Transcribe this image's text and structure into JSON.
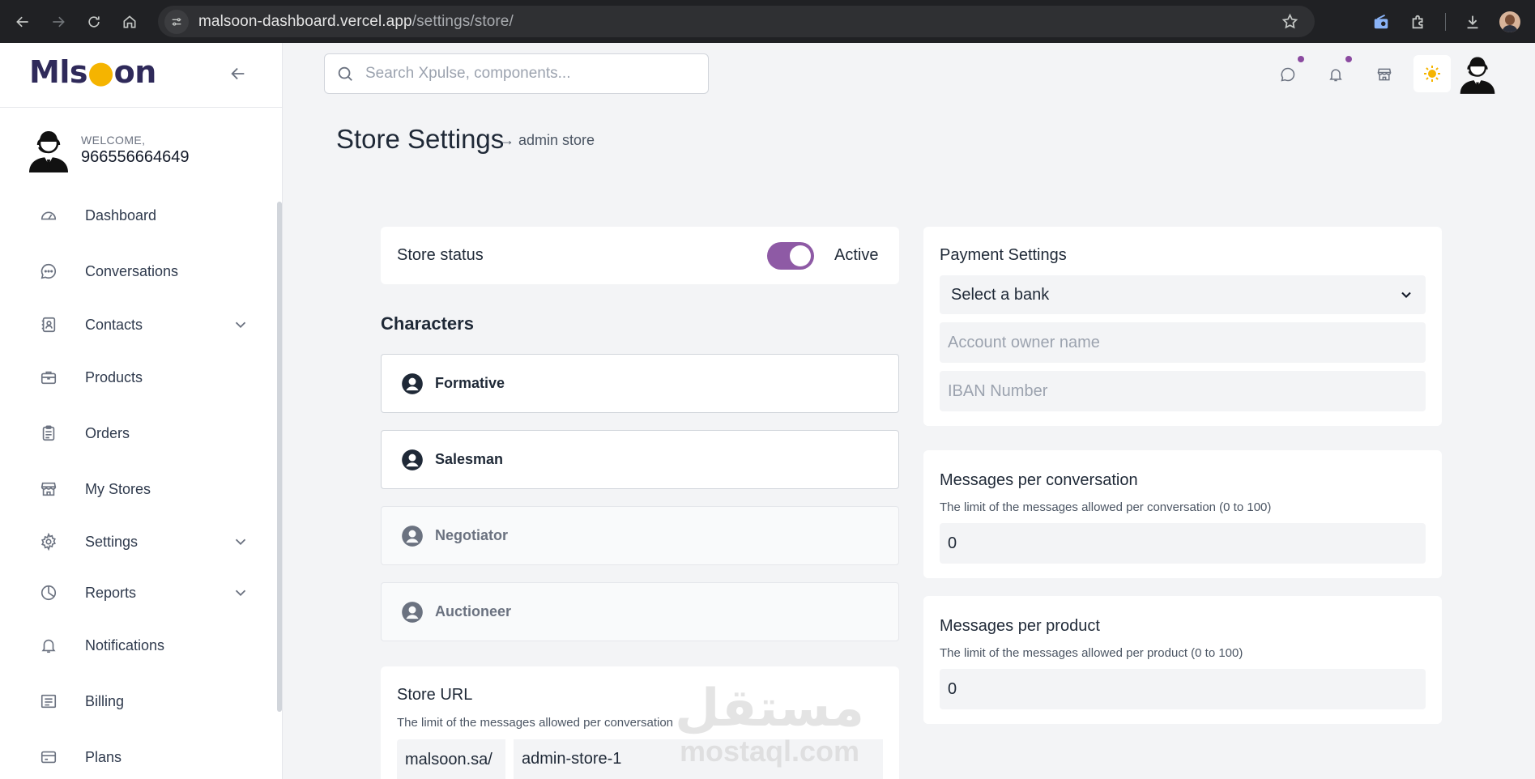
{
  "browser": {
    "url_host": "malsoon-dashboard.vercel.app",
    "url_path": "/settings/store/"
  },
  "sidebar": {
    "logo_text": "Mlsoon",
    "welcome_label": "WELCOME,",
    "user_name": "966556664649",
    "items": [
      {
        "label": "Dashboard",
        "icon": "gauge-icon",
        "has_submenu": false
      },
      {
        "label": "Conversations",
        "icon": "chat-bubble-icon",
        "has_submenu": false
      },
      {
        "label": "Contacts",
        "icon": "contact-book-icon",
        "has_submenu": true
      },
      {
        "label": "Products",
        "icon": "briefcase-icon",
        "has_submenu": false
      },
      {
        "label": "Orders",
        "icon": "clipboard-icon",
        "has_submenu": false
      },
      {
        "label": "My Stores",
        "icon": "store-icon",
        "has_submenu": false
      },
      {
        "label": "Settings",
        "icon": "gear-icon",
        "has_submenu": true
      },
      {
        "label": "Reports",
        "icon": "pie-chart-icon",
        "has_submenu": true
      },
      {
        "label": "Notifications",
        "icon": "bell-icon",
        "has_submenu": false
      },
      {
        "label": "Billing",
        "icon": "receipt-icon",
        "has_submenu": false
      },
      {
        "label": "Plans",
        "icon": "credit-card-icon",
        "has_submenu": false
      }
    ]
  },
  "topbar": {
    "search_placeholder": "Search Xpulse, components..."
  },
  "page": {
    "title": "Store Settings",
    "subtitle": "→ admin store"
  },
  "store_status": {
    "label": "Store status",
    "value": "Active",
    "enabled": true
  },
  "characters": {
    "title": "Characters",
    "items": [
      {
        "label": "Formative",
        "selected": true
      },
      {
        "label": "Salesman",
        "selected": true
      },
      {
        "label": "Negotiator",
        "selected": false
      },
      {
        "label": "Auctioneer",
        "selected": false
      }
    ]
  },
  "store_url": {
    "title": "Store URL",
    "description": "The limit of the messages allowed per conversation",
    "prefix": "malsoon.sa/",
    "value": "admin-store-1"
  },
  "payment": {
    "title": "Payment Settings",
    "bank_select_value": "Select a bank",
    "account_owner_placeholder": "Account owner name",
    "iban_placeholder": "IBAN Number"
  },
  "messages_per_conversation": {
    "title": "Messages per conversation",
    "description": "The limit of the messages allowed per conversation (0 to 100)",
    "value": "0"
  },
  "messages_per_product": {
    "title": "Messages per product",
    "description": "The limit of the messages allowed per product (0 to 100)",
    "value": "0"
  },
  "watermark": {
    "arabic": "مستقل",
    "latin": "mostaql.com"
  },
  "colors": {
    "accent": "#8e5aa5",
    "sidebar_bg": "#ffffff",
    "page_bg": "#f3f4f6",
    "chrome_bg": "#202124"
  }
}
